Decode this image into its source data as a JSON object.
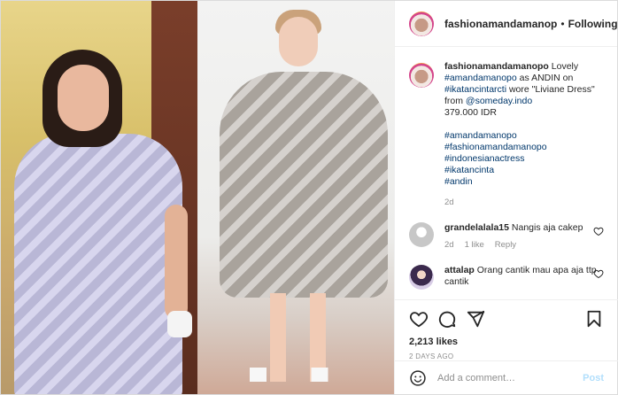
{
  "post": {
    "username": "fashionamandamanop",
    "follow_sep": "•",
    "follow_label": "Following",
    "caption": {
      "username": "fashionamandamanopo",
      "intro": " Lovely ",
      "tag1": "#amandamanopo",
      "as_text": " as ANDIN on",
      "tag2": "#ikatancintarcti",
      "wore_text": " wore \"Liviane Dress\" from ",
      "mention": "@someday.indo",
      "price": "379.000 IDR",
      "hashtags": [
        "#amandamanopo",
        "#fashionamandamanopo",
        "#indonesianactress",
        "#ikatancinta",
        "#andin"
      ],
      "timestamp": "2d"
    },
    "comments": [
      {
        "user": "grandelalala15",
        "text": "Nangis aja cakep",
        "time": "2d",
        "likes": "1 like",
        "reply": "Reply"
      },
      {
        "user": "attalap",
        "text": "Orang cantik mau apa aja ttp cantik"
      }
    ],
    "likes": "2,213 likes",
    "date": "2 DAYS AGO",
    "add_comment_placeholder": "Add a comment…",
    "post_label": "Post"
  }
}
